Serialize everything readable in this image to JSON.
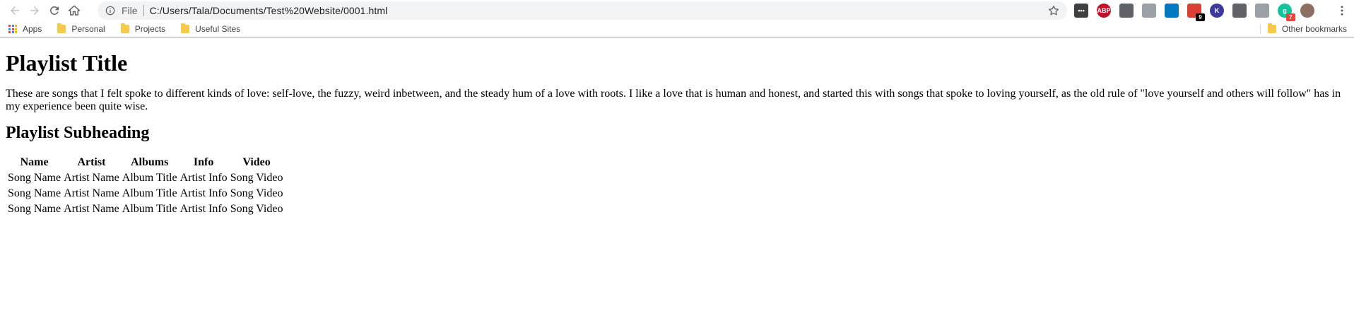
{
  "browser": {
    "omnibox": {
      "scheme_label": "File",
      "url": "C:/Users/Tala/Documents/Test%20Website/0001.html"
    },
    "extensions": [
      {
        "name": "dark-extension-icon",
        "label": "•••",
        "color": "#3c4043"
      },
      {
        "name": "adblock-plus-icon",
        "label": "ABP",
        "color": "#c70d2c"
      },
      {
        "name": "google-drive-icon",
        "label": "",
        "color": "#5f6368"
      },
      {
        "name": "pdf-icon",
        "label": "",
        "color": "#9aa0a6"
      },
      {
        "name": "trello-icon",
        "label": "",
        "color": "#0079bf"
      },
      {
        "name": "todoist-icon",
        "label": "",
        "color": "#db4035",
        "badge": "9",
        "badge_color": "#000000"
      },
      {
        "name": "k-extension-icon",
        "label": "K",
        "color": "#3d3a9e"
      },
      {
        "name": "shield-extension-icon",
        "label": "",
        "color": "#5f6368"
      },
      {
        "name": "snowflake-extension-icon",
        "label": "",
        "color": "#9aa0a6"
      },
      {
        "name": "grammarly-icon",
        "label": "g",
        "color": "#15c39a",
        "badge": "7",
        "badge_color": "#e8453c"
      },
      {
        "name": "profile-avatar",
        "label": "",
        "color": "#8d6e63"
      }
    ],
    "bookmarks": {
      "apps_label": "Apps",
      "items": [
        "Personal",
        "Projects",
        "Useful Sites"
      ],
      "other_label": "Other bookmarks"
    }
  },
  "page": {
    "title": "Playlist Title",
    "description": "These are songs that I felt spoke to different kinds of love: self-love, the fuzzy, weird inbetween, and the steady hum of a love with roots. I like a love that is human and honest, and started this with songs that spoke to loving yourself, as the old rule of \"love yourself and others will follow\" has in my experience been quite wise.",
    "subheading": "Playlist Subheading",
    "table": {
      "headers": [
        "Name",
        "Artist",
        "Albums",
        "Info",
        "Video"
      ],
      "rows": [
        [
          "Song Name",
          "Artist Name",
          "Album Title",
          "Artist Info",
          "Song Video"
        ],
        [
          "Song Name",
          "Artist Name",
          "Album Title",
          "Artist Info",
          "Song Video"
        ],
        [
          "Song Name",
          "Artist Name",
          "Album Title",
          "Artist Info",
          "Song Video"
        ]
      ]
    }
  }
}
